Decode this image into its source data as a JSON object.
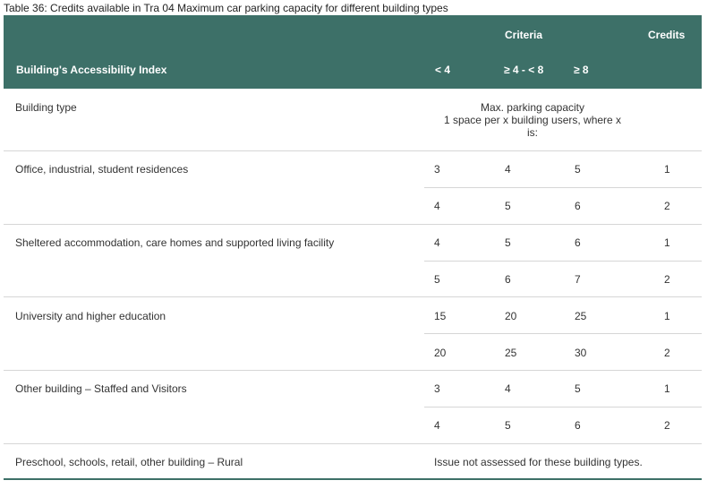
{
  "caption": "Table 36: Credits available in Tra 04 Maximum car parking capacity for different building types",
  "header": {
    "criteria": "Criteria",
    "credits": "Credits",
    "index_label": "Building's Accessibility Index",
    "col1": "< 4",
    "col2": "≥ 4 - < 8",
    "col3": "≥ 8"
  },
  "building_type_label": "Building type",
  "max_capacity_line1": "Max. parking capacity",
  "max_capacity_line2": "1 space per x building users, where x",
  "max_capacity_line3": "is:",
  "groups": [
    {
      "name": "Office, industrial, student residences",
      "rows": [
        {
          "c1": "3",
          "c2": "4",
          "c3": "5",
          "credits": "1"
        },
        {
          "c1": "4",
          "c2": "5",
          "c3": "6",
          "credits": "2"
        }
      ]
    },
    {
      "name": "Sheltered accommodation, care homes and supported living facility",
      "rows": [
        {
          "c1": "4",
          "c2": "5",
          "c3": "6",
          "credits": "1"
        },
        {
          "c1": "5",
          "c2": "6",
          "c3": "7",
          "credits": "2"
        }
      ]
    },
    {
      "name": "University and higher education",
      "rows": [
        {
          "c1": "15",
          "c2": "20",
          "c3": "25",
          "credits": "1"
        },
        {
          "c1": "20",
          "c2": "25",
          "c3": "30",
          "credits": "2"
        }
      ]
    },
    {
      "name": "Other building – Staffed and Visitors",
      "rows": [
        {
          "c1": "3",
          "c2": "4",
          "c3": "5",
          "credits": "1"
        },
        {
          "c1": "4",
          "c2": "5",
          "c3": "6",
          "credits": "2"
        }
      ]
    }
  ],
  "last_row": {
    "name": "Preschool, schools, retail, other building – Rural",
    "note": "Issue not assessed for these building types."
  }
}
